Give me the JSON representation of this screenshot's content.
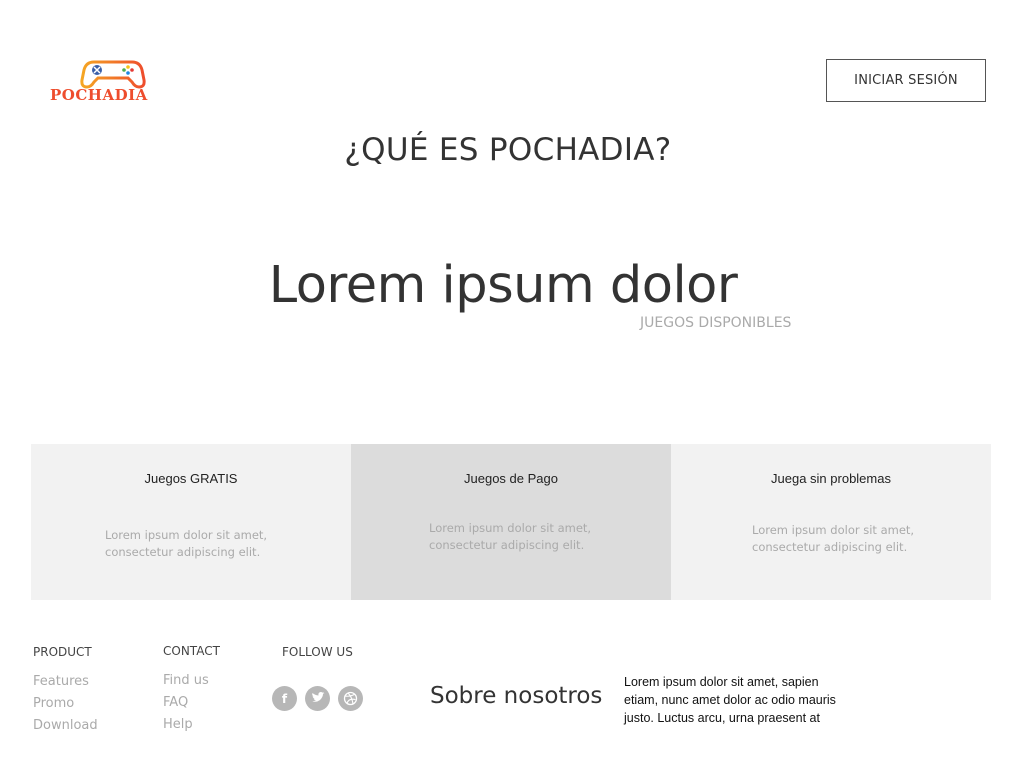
{
  "header": {
    "logo_text": "POCHADIA",
    "login_label": "INICIAR SESIÓN"
  },
  "section": {
    "title": "¿QUÉ ES POCHADIA?"
  },
  "hero": {
    "title": "Lorem ipsum dolor",
    "subtitle": "JUEGOS DISPONIBLES"
  },
  "features": [
    {
      "title": "Juegos GRATIS",
      "text": "Lorem ipsum dolor sit amet, consectetur adipiscing elit."
    },
    {
      "title": "Juegos de Pago",
      "text": "Lorem ipsum dolor sit amet, consectetur adipiscing elit."
    },
    {
      "title": "Juega sin problemas",
      "text": "Lorem ipsum dolor sit amet, consectetur adipiscing elit."
    }
  ],
  "footer": {
    "product": {
      "heading": "PRODUCT",
      "links": [
        "Features",
        "Promo",
        "Download"
      ]
    },
    "contact": {
      "heading": "CONTACT",
      "links": [
        "Find us",
        "FAQ",
        "Help"
      ]
    },
    "follow": {
      "heading": "FOLLOW US",
      "icons": [
        "facebook-icon",
        "twitter-icon",
        "dribbble-icon"
      ]
    },
    "about": {
      "title": "Sobre nosotros",
      "text": "Lorem ipsum dolor sit amet, sapien etiam, nunc amet dolor ac odio mauris justo. Luctus arcu, urna praesent at"
    }
  },
  "colors": {
    "logo_red": "#ee4d2d",
    "logo_orange": "#f5a623",
    "feature_bg": "#f2f2f2",
    "feature_bg_alt": "#dcdcdc",
    "muted_text": "#aaaaaa",
    "social_icon_bg": "#b7b7b7"
  }
}
